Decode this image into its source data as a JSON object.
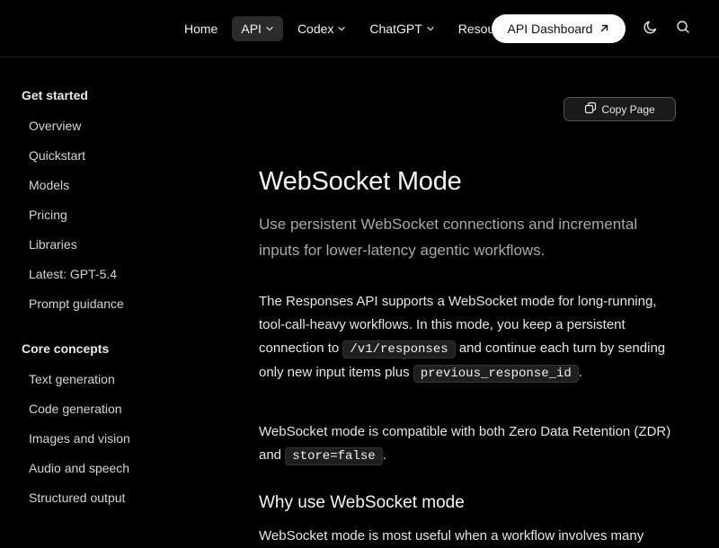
{
  "topnav": {
    "items": [
      {
        "label": "Home",
        "dropdown": false,
        "active": false
      },
      {
        "label": "API",
        "dropdown": true,
        "active": true
      },
      {
        "label": "Codex",
        "dropdown": true,
        "active": false
      },
      {
        "label": "ChatGPT",
        "dropdown": true,
        "active": false
      },
      {
        "label": "Resou",
        "dropdown": false,
        "active": false
      }
    ],
    "dashboard_label": "API Dashboard",
    "icons": [
      "arrow-up-right-icon",
      "moon-icon",
      "search-icon"
    ]
  },
  "sidebar": {
    "sections": [
      {
        "title": "Get started",
        "items": [
          "Overview",
          "Quickstart",
          "Models",
          "Pricing",
          "Libraries",
          "Latest: GPT-5.4",
          "Prompt guidance"
        ]
      },
      {
        "title": "Core concepts",
        "items": [
          "Text generation",
          "Code generation",
          "Images and vision",
          "Audio and speech",
          "Structured output"
        ]
      }
    ]
  },
  "main": {
    "copy_label": "Copy Page",
    "title": "WebSocket Mode",
    "subtitle": "Use persistent WebSocket connections and incremental inputs for lower-latency agentic workflows.",
    "para1": {
      "t1": "The Responses API supports a WebSocket mode for long-running, tool-call-heavy workflows. In this mode, you keep a persistent connection to ",
      "c1": "/v1/responses",
      "t2": " and continue each turn by sending only new input items plus ",
      "c2": "previous_response_id",
      "t3": "."
    },
    "para2": {
      "t1": "WebSocket mode is compatible with both Zero Data Retention (ZDR) and ",
      "c1": "store=false",
      "t2": "."
    },
    "h2": "Why use WebSocket mode",
    "para3": "WebSocket mode is most useful when a workflow involves many"
  }
}
